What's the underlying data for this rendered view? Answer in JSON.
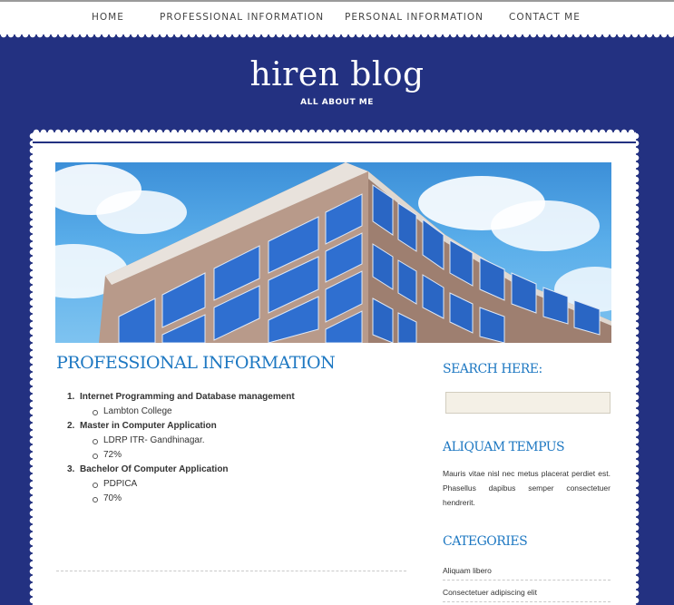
{
  "nav": {
    "items": [
      {
        "label": "HOME"
      },
      {
        "label": "PROFESSIONAL INFORMATION"
      },
      {
        "label": "PERSONAL INFORMATION"
      },
      {
        "label": "CONTACT ME"
      }
    ]
  },
  "header": {
    "title": "hiren blog",
    "tagline": "ALL ABOUT ME"
  },
  "main": {
    "title": "PROFESSIONAL INFORMATION",
    "education": [
      {
        "num": "1.",
        "title": "Internet Programming and Database management",
        "details": [
          "Lambton College"
        ]
      },
      {
        "num": "2.",
        "title": "Master in Computer Application",
        "details": [
          "LDRP ITR- Gandhinagar.",
          "72%"
        ]
      },
      {
        "num": "3.",
        "title": "Bachelor Of Computer Application",
        "details": [
          "PDPICA",
          "70%"
        ]
      }
    ]
  },
  "sidebar": {
    "search_title": "SEARCH HERE:",
    "search_value": "",
    "aliquam_title": "ALIQUAM TEMPUS",
    "aliquam_text": "Mauris vitae nisl nec metus placerat perdiet est. Phasellus dapibus semper consectetuer hendrerit.",
    "categories_title": "CATEGORIES",
    "categories": [
      {
        "label": "Aliquam libero"
      },
      {
        "label": "Consectetuer adipiscing elit"
      }
    ]
  },
  "colors": {
    "background": "#233181",
    "accent": "#1e78c2",
    "search_bg": "#f4f0e6"
  },
  "icons": [
    "building-photo"
  ]
}
